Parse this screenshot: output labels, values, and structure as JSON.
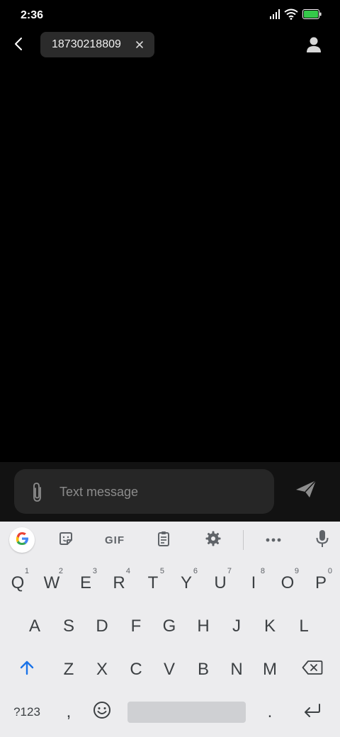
{
  "status_bar": {
    "time": "2:36",
    "icons": [
      "signal-icon",
      "wifi-icon",
      "battery-icon"
    ],
    "battery_color": "#35c94a"
  },
  "header": {
    "back_icon": "back-arrow-icon",
    "recipient": "18730218809",
    "remove_icon": "close-icon",
    "contact_icon": "person-icon"
  },
  "compose": {
    "placeholder": "Text message",
    "value": "",
    "attach_icon": "paperclip-icon",
    "send_icon": "send-icon"
  },
  "keyboard": {
    "toolbar": {
      "google_icon": "google-icon",
      "sticker_icon": "sticker-icon",
      "gif_label": "GIF",
      "clipboard_icon": "clipboard-icon",
      "settings_icon": "gear-icon",
      "more_icon": "more-icon",
      "mic_icon": "mic-icon"
    },
    "row1": [
      {
        "key": "Q",
        "hint": "1"
      },
      {
        "key": "W",
        "hint": "2"
      },
      {
        "key": "E",
        "hint": "3"
      },
      {
        "key": "R",
        "hint": "4"
      },
      {
        "key": "T",
        "hint": "5"
      },
      {
        "key": "Y",
        "hint": "6"
      },
      {
        "key": "U",
        "hint": "7"
      },
      {
        "key": "I",
        "hint": "8"
      },
      {
        "key": "O",
        "hint": "9"
      },
      {
        "key": "P",
        "hint": "0"
      }
    ],
    "row2": [
      "A",
      "S",
      "D",
      "F",
      "G",
      "H",
      "J",
      "K",
      "L"
    ],
    "row3": [
      "Z",
      "X",
      "C",
      "V",
      "B",
      "N",
      "M"
    ],
    "bottom": {
      "symbols_label": "?123",
      "comma_label": ",",
      "period_label": ".",
      "shift_icon": "shift-icon",
      "backspace_icon": "backspace-icon",
      "emoji_icon": "emoji-icon",
      "enter_icon": "enter-icon"
    },
    "accent_color": "#1a73e8"
  }
}
